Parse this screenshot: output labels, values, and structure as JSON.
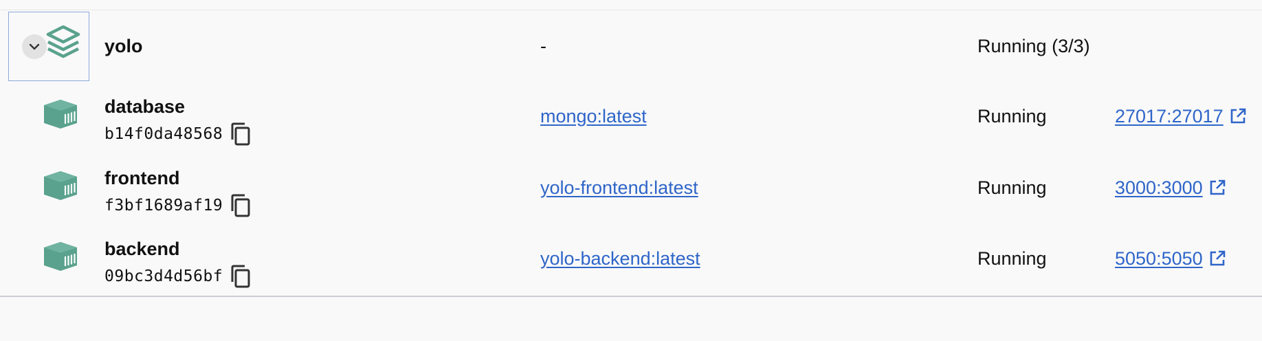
{
  "colors": {
    "accent_green": "#5aa28d",
    "link_blue": "#2e65c9",
    "selection_border": "#8ea8db",
    "background": "#f9f9f9"
  },
  "group": {
    "name": "yolo",
    "image": "-",
    "status": "Running (3/3)",
    "expanded": true,
    "icons": {
      "toggle": "chevron-down-icon",
      "type": "stack-layers-icon"
    }
  },
  "containers": [
    {
      "name": "database",
      "id": "b14f0da48568",
      "image": "mongo:latest",
      "status": "Running",
      "port": "27017:27017"
    },
    {
      "name": "frontend",
      "id": "f3bf1689af19",
      "image": "yolo-frontend:latest",
      "status": "Running",
      "port": "3000:3000"
    },
    {
      "name": "backend",
      "id": "09bc3d4d56bf",
      "image": "yolo-backend:latest",
      "status": "Running",
      "port": "5050:5050"
    }
  ],
  "icons": {
    "container": "container-cube-icon",
    "copy": "copy-icon",
    "external_link": "external-link-icon"
  }
}
